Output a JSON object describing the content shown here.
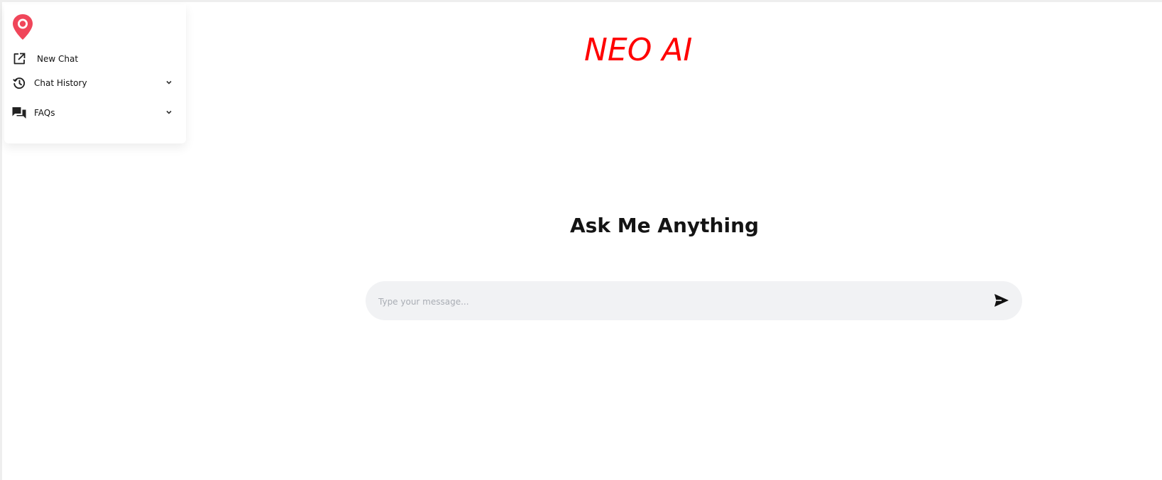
{
  "app": {
    "brand_title": "NEO AI",
    "brand_color": "#ff0000",
    "logo_icon": "location-pin-icon",
    "logo_color": "#f0465a"
  },
  "sidebar": {
    "items": [
      {
        "label": "New Chat",
        "icon": "external-edit-icon"
      },
      {
        "label": "Chat History",
        "icon": "history-icon",
        "has_chevron": true
      },
      {
        "label": "FAQs",
        "icon": "chat-bubbles-icon",
        "has_chevron": true
      }
    ]
  },
  "main": {
    "headline": "Ask Me Anything",
    "message_input": {
      "placeholder": "Type your message...",
      "value": ""
    },
    "send_icon": "send-icon"
  }
}
